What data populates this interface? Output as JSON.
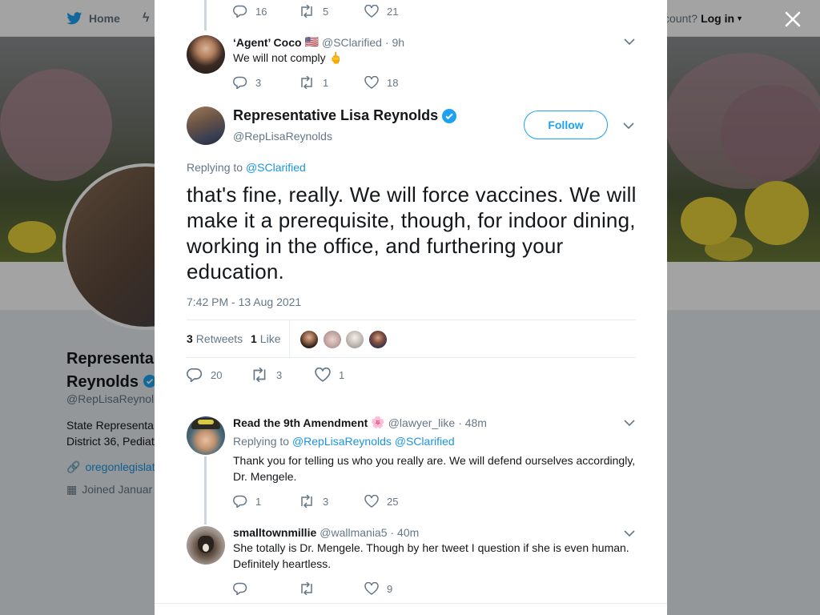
{
  "background": {
    "nav_home": "Home",
    "account_prompt": "count?",
    "login_label": "Log in",
    "profile_name_line1": "Representa",
    "profile_name_line2": "Reynolds",
    "profile_handle": "@RepLisaReynol",
    "bio_line1": "State Representa",
    "bio_line2": "District 36, Pediat",
    "website": "oregonlegislat",
    "joined": "Joined Januar"
  },
  "thread": {
    "top_tweet_actions": {
      "replies": "16",
      "retweets": "5",
      "likes": "21"
    },
    "coco": {
      "name": "‘Agent’ Coco",
      "flag": "🇺🇸",
      "handle": "@SClarified",
      "time": "· 9h",
      "text": "We will not comply 🖕",
      "replies": "3",
      "retweets": "1",
      "likes": "18"
    }
  },
  "main_tweet": {
    "name": "Representative Lisa Reynolds",
    "handle": "@RepLisaReynolds",
    "follow_label": "Follow",
    "replying_prefix": "Replying to",
    "replying_to": "@SClarified",
    "text": "that's fine, really. We will force vaccines. We will make it a prerequisite, though, for indoor dining, working in the office, and furthering your education.",
    "timestamp": "7:42 PM - 13 Aug 2021",
    "retweets_count": "3",
    "retweets_label": "Retweets",
    "likes_count": "1",
    "likes_label": "Like",
    "replies": "20",
    "retweets": "3",
    "likes": "1"
  },
  "replies": [
    {
      "name": "Read the 9th Amendment",
      "emoji": "🌸",
      "handle": "@lawyer_like",
      "time": "· 48m",
      "replying_prefix": "Replying to",
      "replying_to": "@RepLisaReynolds @SClarified",
      "text": "Thank you for telling us who you really are. We will defend ourselves accordingly, Dr. Mengele.",
      "replies": "1",
      "retweets": "3",
      "likes": "25"
    },
    {
      "name": "smalltownmillie",
      "handle": "@wallmania5",
      "time": "· 40m",
      "text": "She totally is Dr. Mengele. Though by her tweet I question if she is even human. Definitely heartless.",
      "replies": "",
      "retweets": "",
      "likes": "9"
    }
  ],
  "colors": {
    "accent": "#1da1f2",
    "link": "#1b95e0",
    "muted": "#657786",
    "verified": "#1da1f2"
  }
}
